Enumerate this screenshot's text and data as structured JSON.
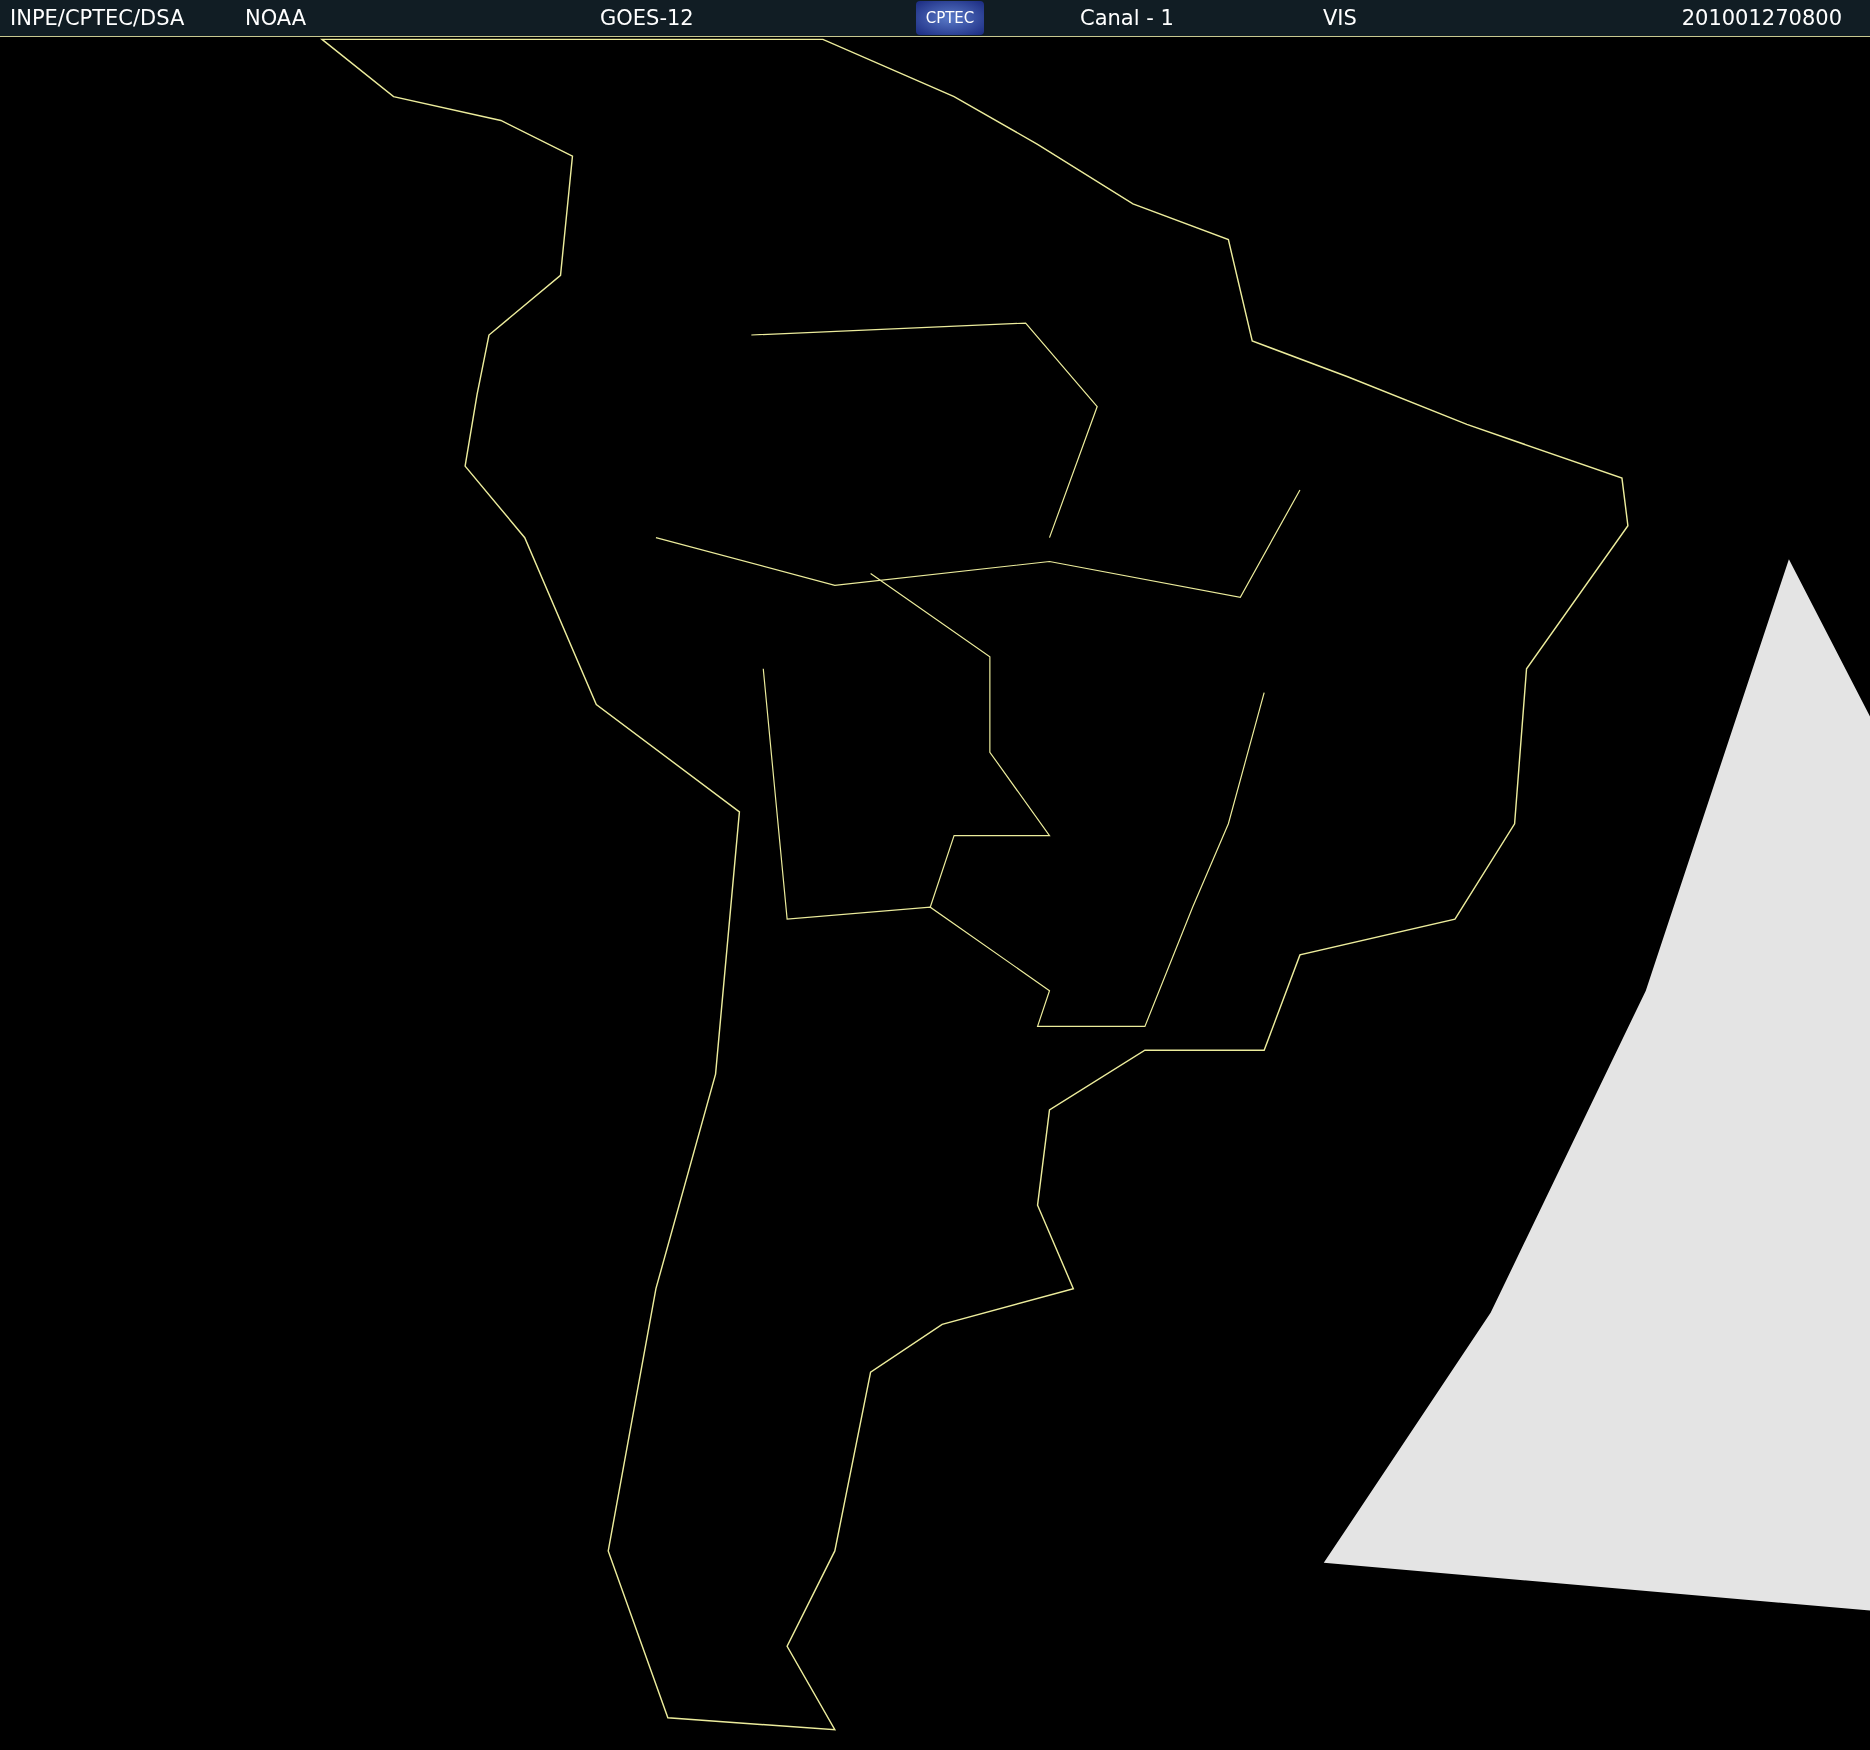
{
  "header": {
    "source": "INPE/CPTEC/DSA",
    "agency": "NOAA",
    "satellite": "GOES-12",
    "logo": "CPTEC",
    "channel": "Canal - 1",
    "band": "VIS",
    "timestamp": "201001270800"
  }
}
